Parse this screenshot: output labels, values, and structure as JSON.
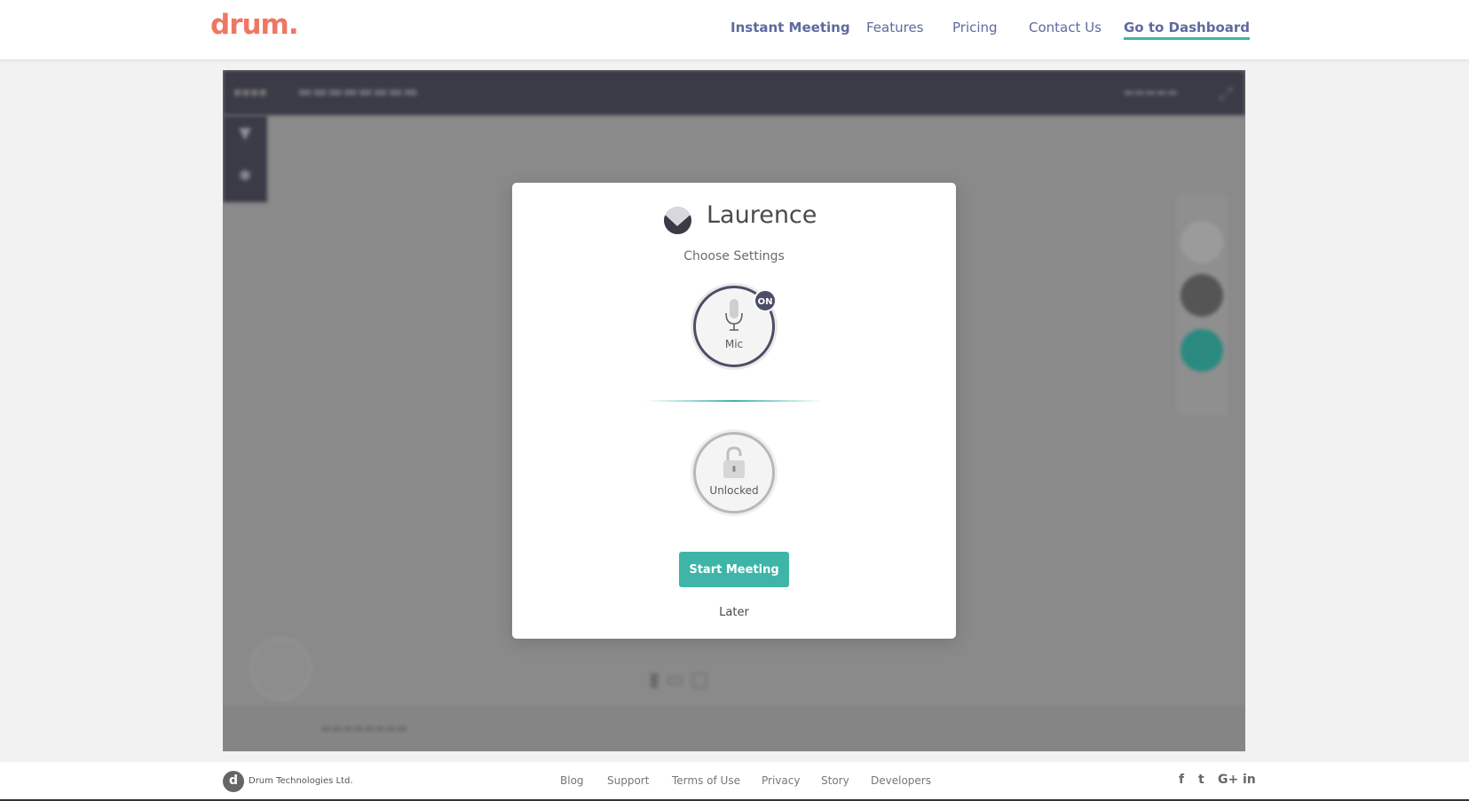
{
  "header": {
    "logo": "drum.",
    "nav": {
      "instant_meeting": "Instant Meeting",
      "features": "Features",
      "pricing": "Pricing",
      "contact": "Contact Us",
      "dashboard": "Go to Dashboard"
    }
  },
  "modal": {
    "user_name": "Laurence",
    "subtitle": "Choose Settings",
    "mic": {
      "label": "Mic",
      "badge": "ON"
    },
    "lock": {
      "label": "Unlocked"
    },
    "start_button": "Start Meeting",
    "later": "Later"
  },
  "footer": {
    "company": "Drum Technologies Ltd.",
    "company_logo": "d",
    "links": {
      "blog": "Blog",
      "support": "Support",
      "terms": "Terms of Use",
      "privacy": "Privacy",
      "story": "Story",
      "developers": "Developers"
    },
    "social": {
      "facebook": "f",
      "twitter": "t",
      "googleplus": "G+",
      "linkedin": "in"
    }
  },
  "colors": {
    "brand": "#ee7763",
    "nav": "#5e6a9e",
    "accent": "#3fb5a7",
    "dark": "#4c4e66"
  }
}
